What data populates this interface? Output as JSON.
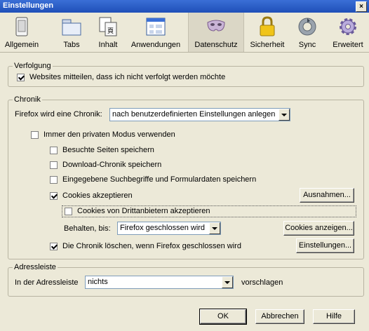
{
  "window": {
    "title": "Einstellungen",
    "close_label": "×"
  },
  "toolbar": [
    {
      "label": "Allgemein",
      "icon": "switch-icon"
    },
    {
      "label": "Tabs",
      "icon": "tabs-icon"
    },
    {
      "label": "Inhalt",
      "icon": "content-icon"
    },
    {
      "label": "Anwendungen",
      "icon": "applications-icon"
    },
    {
      "label": "Datenschutz",
      "icon": "privacy-mask-icon"
    },
    {
      "label": "Sicherheit",
      "icon": "lock-icon"
    },
    {
      "label": "Sync",
      "icon": "sync-icon"
    },
    {
      "label": "Erweitert",
      "icon": "gear-icon"
    }
  ],
  "tracking": {
    "legend": "Verfolgung",
    "dnt_label": "Websites mitteilen, dass ich nicht verfolgt werden möchte",
    "dnt_checked": true
  },
  "history": {
    "legend": "Chronik",
    "mode_label": "Firefox wird eine Chronik:",
    "mode_value": "nach benutzerdefinierten Einstellungen anlegen",
    "private_label": "Immer den privaten Modus verwenden",
    "visited_label": "Besuchte Seiten speichern",
    "download_label": "Download-Chronik speichern",
    "search_label": "Eingegebene Suchbegriffe und Formulardaten speichern",
    "cookies_label": "Cookies akzeptieren",
    "exceptions_button": "Ausnahmen...",
    "thirdparty_label": "Cookies von Drittanbietern akzeptieren",
    "keep_label": "Behalten, bis:",
    "keep_value": "Firefox geschlossen wird",
    "show_cookies_button": "Cookies anzeigen...",
    "clear_label": "Die Chronik löschen, wenn Firefox geschlossen wird",
    "settings_button": "Einstellungen..."
  },
  "addressbar": {
    "legend": "Adressleiste",
    "label": "In der Adressleiste",
    "value": "nichts",
    "suffix": "vorschlagen"
  },
  "footer": {
    "ok": "OK",
    "cancel": "Abbrechen",
    "help": "Hilfe"
  }
}
